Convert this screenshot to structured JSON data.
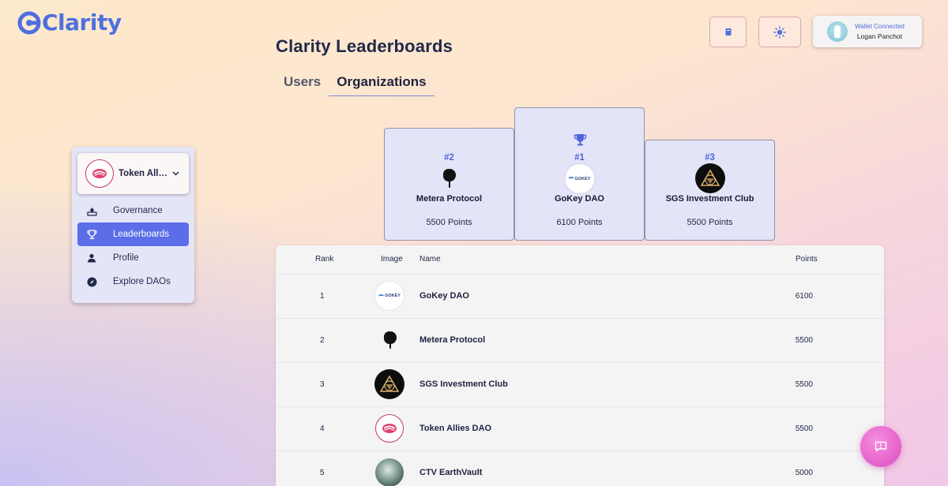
{
  "brand": {
    "name": "Clarity",
    "accent": "#4f6fe0"
  },
  "header": {
    "docs_icon": "book-icon",
    "theme_icon": "sun-icon",
    "wallet": {
      "status": "Wallet Connected",
      "user": "Logan Panchot"
    }
  },
  "page": {
    "title": "Clarity Leaderboards",
    "tabs": [
      {
        "label": "Users",
        "active": false
      },
      {
        "label": "Organizations",
        "active": true
      }
    ]
  },
  "sidebar": {
    "selected_dao": "Token Allies DAO",
    "selected_dao_display": "Token Allie...",
    "items": [
      {
        "label": "Governance",
        "icon": "ballot-icon",
        "active": false
      },
      {
        "label": "Leaderboards",
        "icon": "trophy-icon",
        "active": true
      },
      {
        "label": "Profile",
        "icon": "person-icon",
        "active": false
      },
      {
        "label": "Explore DAOs",
        "icon": "compass-icon",
        "active": false
      }
    ]
  },
  "podium": {
    "first": {
      "rank": "#1",
      "name": "GoKey DAO",
      "points": "6100 Points"
    },
    "second": {
      "rank": "#2",
      "name": "Metera Protocol",
      "points": "5500 Points"
    },
    "third": {
      "rank": "#3",
      "name": "SGS Investment Club",
      "points": "5500 Points"
    }
  },
  "table": {
    "headers": {
      "rank": "Rank",
      "image": "Image",
      "name": "Name",
      "points": "Points"
    },
    "rows": [
      {
        "rank": "1",
        "name": "GoKey DAO",
        "points": "6100",
        "logo": "gokey"
      },
      {
        "rank": "2",
        "name": "Metera Protocol",
        "points": "5500",
        "logo": "metera"
      },
      {
        "rank": "3",
        "name": "SGS Investment Club",
        "points": "5500",
        "logo": "sgs"
      },
      {
        "rank": "4",
        "name": "Token Allies DAO",
        "points": "5500",
        "logo": "allies"
      },
      {
        "rank": "5",
        "name": "CTV EarthVault",
        "points": "5000",
        "logo": "ctv"
      }
    ]
  },
  "fab": {
    "icon": "feedback-icon"
  }
}
